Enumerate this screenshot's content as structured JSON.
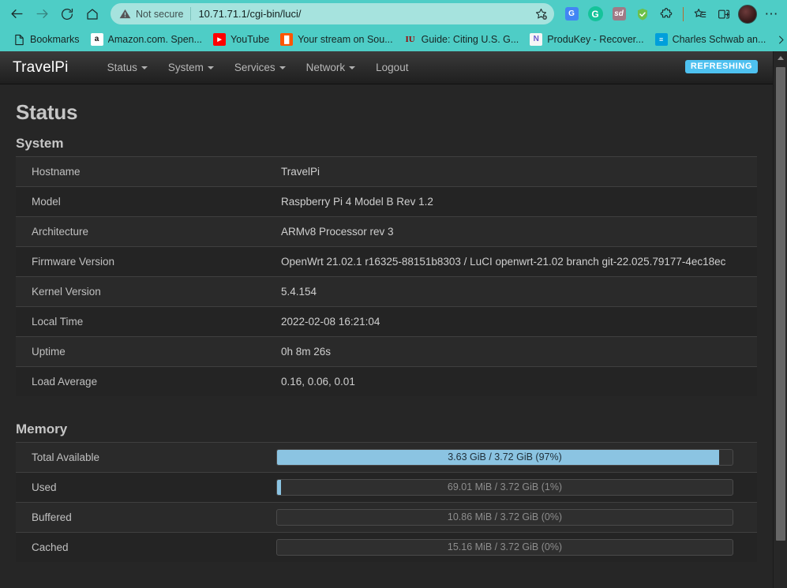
{
  "browser": {
    "nav_buttons": [
      {
        "name": "back-button",
        "icon": "arrow-left-icon"
      },
      {
        "name": "forward-button",
        "icon": "arrow-right-icon"
      },
      {
        "name": "reload-button",
        "icon": "reload-icon"
      },
      {
        "name": "home-button",
        "icon": "home-icon"
      }
    ],
    "omnibox": {
      "security_label": "Not secure",
      "security_icon": "warning-triangle-icon",
      "url": "10.71.71.1/cgi-bin/luci/",
      "bookmark_icon": "star-add-icon"
    },
    "extensions": [
      {
        "name": "google-translate-extension",
        "glyph": "G",
        "color": "#4285f4"
      },
      {
        "name": "grammarly-extension",
        "glyph": "G",
        "color": "#15c39a"
      },
      {
        "name": "stands-adblocker-extension",
        "glyph": "sd",
        "color": "#a07a86"
      },
      {
        "name": "shield-extension",
        "glyph": "✓",
        "color": "#6cc04a"
      },
      {
        "name": "extensions-puzzle-icon",
        "glyph": "",
        "color": "transparent"
      }
    ],
    "toolbar_right": [
      {
        "name": "collections-icon"
      },
      {
        "name": "split-screen-icon"
      },
      {
        "name": "profile-avatar"
      },
      {
        "name": "settings-more-icon",
        "glyph": "⋯"
      }
    ],
    "bookmarks": [
      {
        "label": "Bookmarks",
        "favicon": "folder-page-icon",
        "color": "#ffffff",
        "glyph": ""
      },
      {
        "label": "Amazon.com. Spen...",
        "favicon": "amazon-icon",
        "color": "#ffffff",
        "glyph": "a"
      },
      {
        "label": "YouTube",
        "favicon": "youtube-icon",
        "color": "#ff0000",
        "glyph": "▶"
      },
      {
        "label": "Your stream on Sou...",
        "favicon": "soundcloud-icon",
        "color": "#ff5500",
        "glyph": "█"
      },
      {
        "label": "Guide: Citing U.S. G...",
        "favicon": "indiana-university-icon",
        "color": "#990000",
        "glyph": "IU"
      },
      {
        "label": "ProduKey - Recover...",
        "favicon": "produkey-icon",
        "color": "#f4f4f4",
        "glyph": "N"
      },
      {
        "label": "Charles Schwab an...",
        "favicon": "charles-schwab-icon",
        "color": "#009fdb",
        "glyph": "≡"
      }
    ],
    "bookmarks_overflow_icon": "chevron-right-icon"
  },
  "luci": {
    "brand": "TravelPi",
    "nav": [
      {
        "label": "Status",
        "has_caret": true
      },
      {
        "label": "System",
        "has_caret": true
      },
      {
        "label": "Services",
        "has_caret": true
      },
      {
        "label": "Network",
        "has_caret": true
      },
      {
        "label": "Logout",
        "has_caret": false
      }
    ],
    "refresh_badge": "REFRESHING",
    "refresh_badge_color": "#4ec1f0",
    "page_title": "Status",
    "sections": {
      "system": {
        "title": "System",
        "rows": [
          {
            "key": "Hostname",
            "value": "TravelPi"
          },
          {
            "key": "Model",
            "value": "Raspberry Pi 4 Model B Rev 1.2"
          },
          {
            "key": "Architecture",
            "value": "ARMv8 Processor rev 3"
          },
          {
            "key": "Firmware Version",
            "value": "OpenWrt 21.02.1 r16325-88151b8303 / LuCI openwrt-21.02 branch git-22.025.79177-4ec18ec"
          },
          {
            "key": "Kernel Version",
            "value": "5.4.154"
          },
          {
            "key": "Local Time",
            "value": "2022-02-08 16:21:04"
          },
          {
            "key": "Uptime",
            "value": "0h 8m 26s"
          },
          {
            "key": "Load Average",
            "value": "0.16, 0.06, 0.01"
          }
        ]
      },
      "memory": {
        "title": "Memory",
        "rows": [
          {
            "key": "Total Available",
            "label": "3.63 GiB / 3.72 GiB (97%)",
            "percent": 97,
            "label_style": "dark"
          },
          {
            "key": "Used",
            "label": "69.01 MiB / 3.72 GiB (1%)",
            "percent": 1,
            "label_style": "muted"
          },
          {
            "key": "Buffered",
            "label": "10.86 MiB / 3.72 GiB (0%)",
            "percent": 0,
            "label_style": "muted"
          },
          {
            "key": "Cached",
            "label": "15.16 MiB / 3.72 GiB (0%)",
            "percent": 0,
            "label_style": "muted"
          }
        ]
      }
    },
    "progress_fill_color": "#8bc4e2"
  }
}
